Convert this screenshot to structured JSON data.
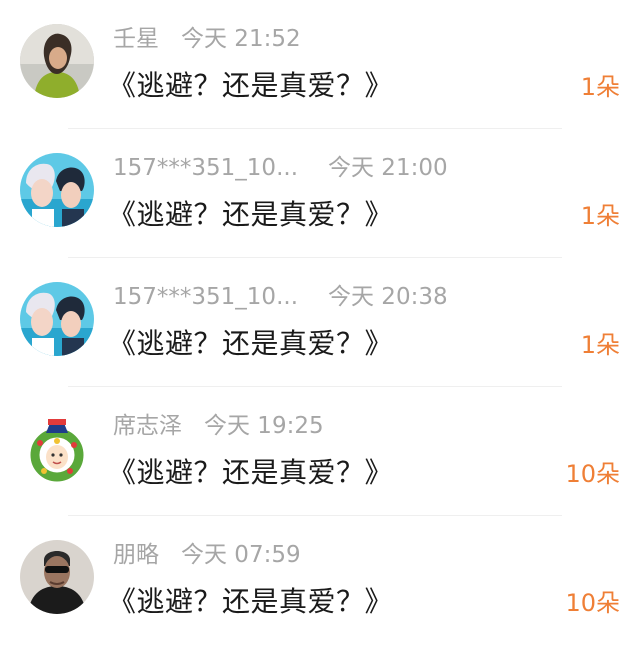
{
  "entries": [
    {
      "name": "壬星",
      "time": "今天 21:52",
      "title": "《逃避？还是真爱？》",
      "count": "1朵",
      "avatar_icon": "user-avatar-icon"
    },
    {
      "name": "157***351_10...",
      "time": "今天 21:00",
      "title": "《逃避？还是真爱？》",
      "count": "1朵",
      "avatar_icon": "user-avatar-icon"
    },
    {
      "name": "157***351_10...",
      "time": "今天 20:38",
      "title": "《逃避？还是真爱？》",
      "count": "1朵",
      "avatar_icon": "user-avatar-icon"
    },
    {
      "name": "席志泽",
      "time": "今天 19:25",
      "title": "《逃避？还是真爱？》",
      "count": "10朵",
      "avatar_icon": "wreath-avatar-icon"
    },
    {
      "name": "朋略",
      "time": "今天 07:59",
      "title": "《逃避？还是真爱？》",
      "count": "10朵",
      "avatar_icon": "user-avatar-icon"
    }
  ],
  "colors": {
    "count_accent": "#ef7f36",
    "meta_gray": "#a6a6a6",
    "title_text": "#1a1a1a"
  }
}
